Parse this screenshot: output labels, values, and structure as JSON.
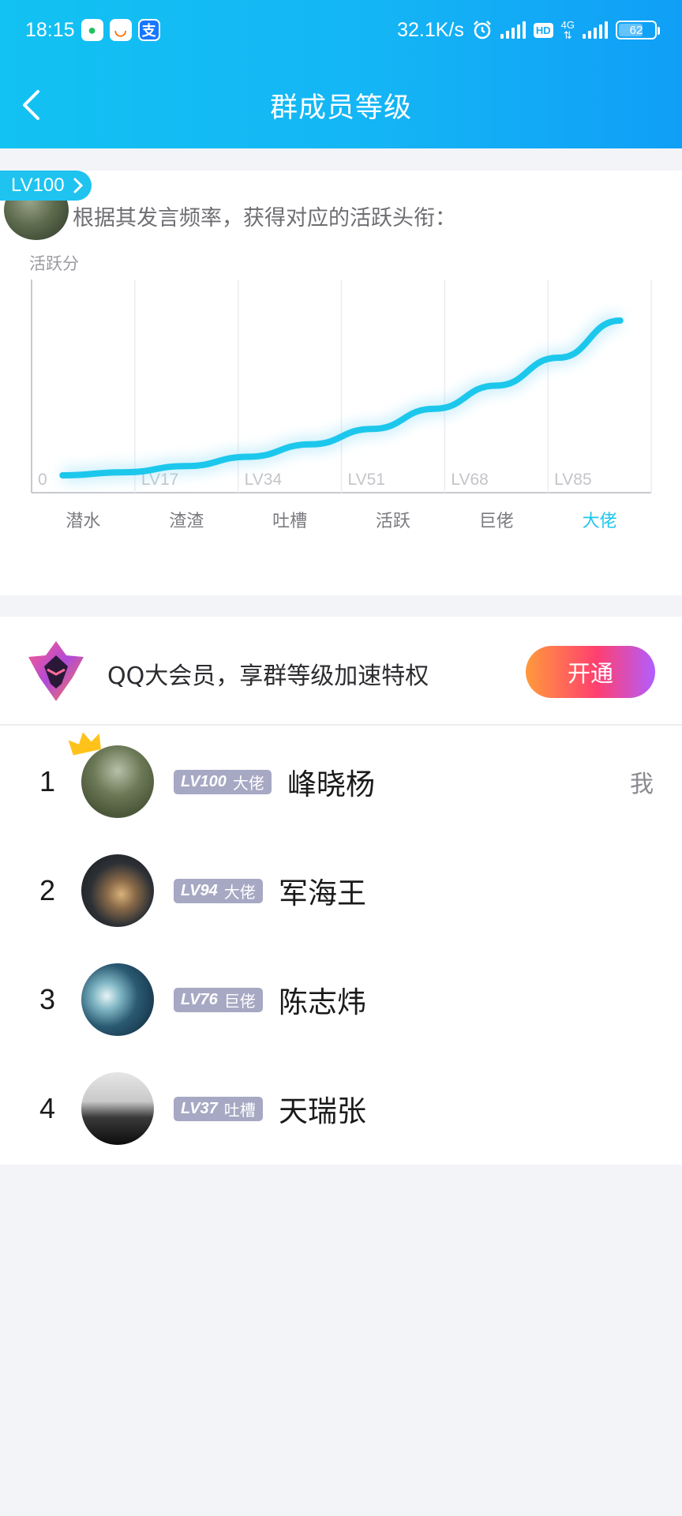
{
  "status_bar": {
    "time": "18:15",
    "net_speed": "32.1K/s",
    "hd": "HD",
    "net_type": "4G",
    "battery": "62"
  },
  "nav": {
    "title": "群成员等级"
  },
  "chart_card": {
    "badge_label": "LV100",
    "intro_text": "根据其发言频率，获得对应的活跃头衔：",
    "chart_data": {
      "type": "line",
      "ylabel": "活跃分",
      "x": [
        "0",
        "LV17",
        "LV34",
        "LV51",
        "LV68",
        "LV85"
      ],
      "categories": [
        "潜水",
        "渣渣",
        "吐槽",
        "活跃",
        "巨佬",
        "大佬"
      ],
      "highlight_category": "大佬",
      "x_range": [
        0,
        100
      ],
      "curve_levels": [
        5,
        15,
        25,
        35,
        45,
        55,
        65,
        75,
        85,
        95
      ],
      "curve_relative_score": [
        0.0,
        0.02,
        0.06,
        0.12,
        0.2,
        0.3,
        0.43,
        0.58,
        0.76,
        1.0
      ],
      "grid": true,
      "accent": "#1cc7ec"
    }
  },
  "promo": {
    "text": "QQ大会员，享群等级加速特权",
    "button_label": "开通",
    "button_gradient": [
      "#ff9a3c",
      "#ff3f6f",
      "#b25dff"
    ]
  },
  "members": [
    {
      "rank": "1",
      "lv": "LV100",
      "title": "大佬",
      "name": "峰晓杨",
      "me": "我"
    },
    {
      "rank": "2",
      "lv": "LV94",
      "title": "大佬",
      "name": "军海王"
    },
    {
      "rank": "3",
      "lv": "LV76",
      "title": "巨佬",
      "name": "陈志炜"
    },
    {
      "rank": "4",
      "lv": "LV37",
      "title": "吐槽",
      "name": "天瑞张"
    }
  ]
}
